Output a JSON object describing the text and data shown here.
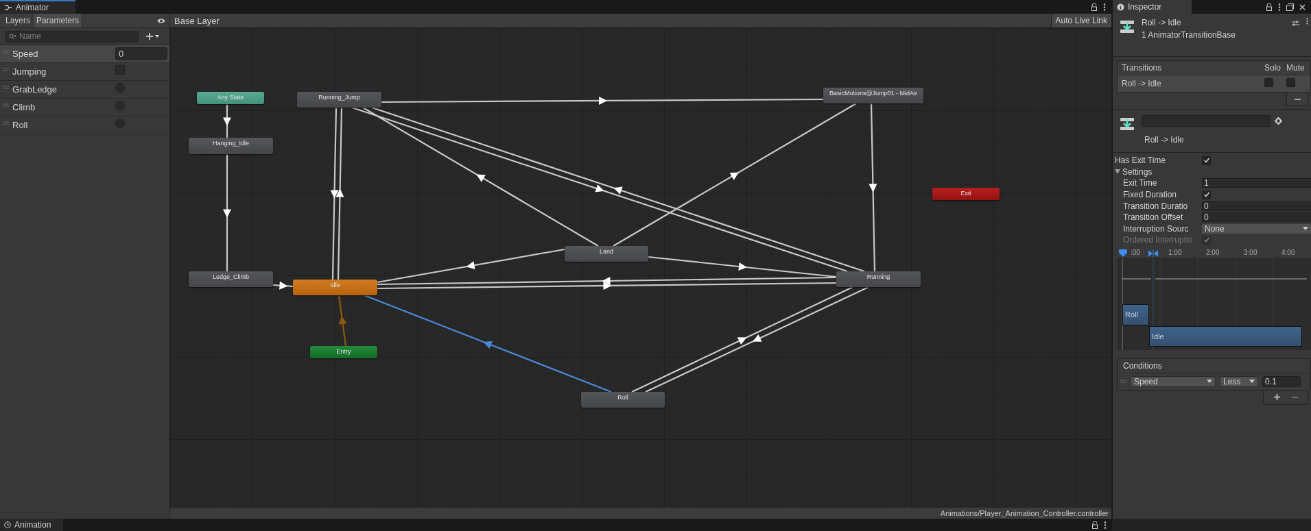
{
  "window": {
    "tab": "Animator"
  },
  "parameters_panel": {
    "tabs": [
      {
        "label": "Layers",
        "selected": false
      },
      {
        "label": "Parameters",
        "selected": true
      }
    ],
    "search": {
      "placeholder": "Name"
    },
    "parameters": [
      {
        "name": "Speed",
        "kind": "float",
        "value": "0",
        "selected": true
      },
      {
        "name": "Jumping",
        "kind": "bool",
        "checked": false,
        "selected": false
      },
      {
        "name": "GrabLedge",
        "kind": "trigger",
        "checked": false,
        "selected": false
      },
      {
        "name": "Climb",
        "kind": "trigger",
        "checked": false,
        "selected": false
      },
      {
        "name": "Roll",
        "kind": "trigger",
        "checked": false,
        "selected": false
      }
    ]
  },
  "graph": {
    "breadcrumb": "Base Layer",
    "live_link_button": "Auto Live Link",
    "states": [
      {
        "label": "Any State",
        "kind": "any"
      },
      {
        "label": "Running_Jump",
        "kind": "state"
      },
      {
        "label": "BasicMotions@Jump01 - MidAir",
        "kind": "state"
      },
      {
        "label": "Hanging_Idle",
        "kind": "state"
      },
      {
        "label": "Idle",
        "kind": "default"
      },
      {
        "label": "Ledge_Climb",
        "kind": "state"
      },
      {
        "label": "Land",
        "kind": "state"
      },
      {
        "label": "Running",
        "kind": "state"
      },
      {
        "label": "Exit",
        "kind": "exit"
      },
      {
        "label": "Entry",
        "kind": "entry"
      },
      {
        "label": "Roll",
        "kind": "state"
      }
    ],
    "status_path": "Animations/Player_Animation_Controller.controller"
  },
  "inspector": {
    "tab": "Inspector",
    "title": "Roll -> Idle",
    "subtitle": "1 AnimatorTransitionBase",
    "transitions": {
      "columns": [
        "Transitions",
        "Solo",
        "Mute"
      ],
      "rows": [
        {
          "name": "Roll -> Idle",
          "solo": false,
          "mute": false,
          "selected": true
        }
      ]
    },
    "transition_name": "Roll -> Idle",
    "has_exit_time": {
      "label": "Has Exit Time",
      "checked": true
    },
    "settings": {
      "label": "Settings",
      "expanded": true,
      "fields": [
        {
          "label": "Exit Time",
          "kind": "number",
          "value": "1",
          "disabled": false
        },
        {
          "label": "Fixed Duration",
          "kind": "checkbox",
          "checked": true,
          "disabled": false
        },
        {
          "label": "Transition Duratio",
          "kind": "number",
          "value": "0",
          "disabled": false
        },
        {
          "label": "Transition Offset",
          "kind": "number",
          "value": "0",
          "disabled": false
        },
        {
          "label": "Interruption Sourc",
          "kind": "dropdown",
          "value": "None",
          "disabled": false
        },
        {
          "label": "Ordered Interruptio",
          "kind": "checkbox",
          "checked": true,
          "disabled": true
        }
      ]
    },
    "timeline": {
      "ticks": [
        ":00",
        "1:00",
        "2:00",
        "3:00",
        "4:00"
      ],
      "clips": [
        {
          "label": "Roll"
        },
        {
          "label": "Idle"
        }
      ]
    },
    "conditions": {
      "title": "Conditions",
      "rows": [
        {
          "parameter": "Speed",
          "mode": "Less",
          "value": "0.1"
        }
      ]
    }
  },
  "bottom_tab": "Animation"
}
